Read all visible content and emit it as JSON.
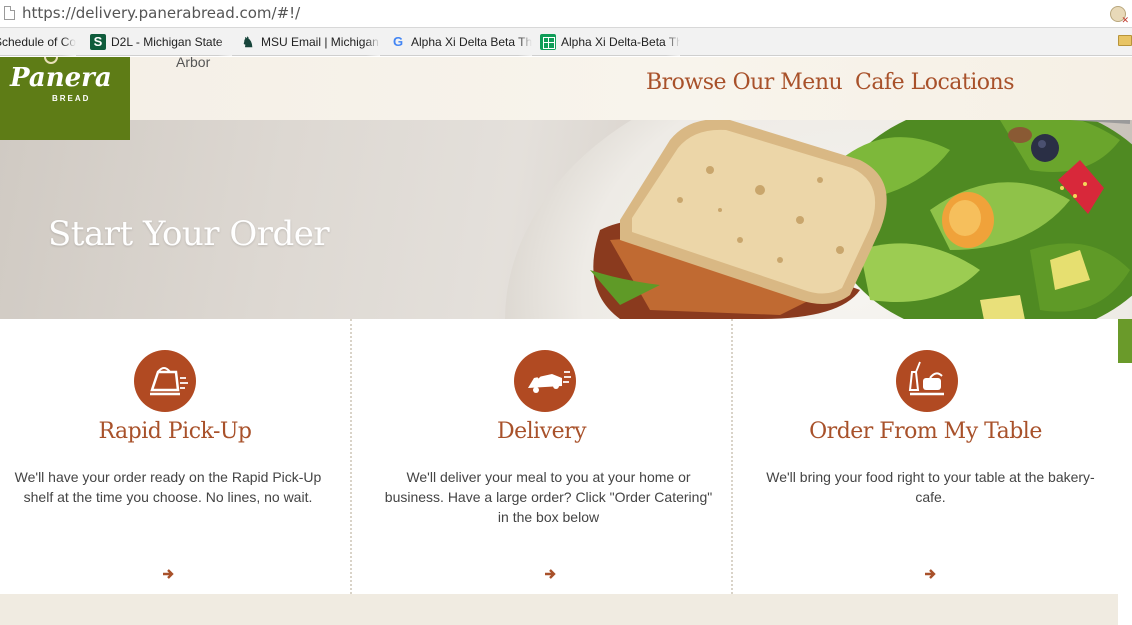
{
  "browser": {
    "url": "https://delivery.panerabread.com/#!/",
    "bookmarks": [
      {
        "label": "Schedule of Cou",
        "icon": "page-icon"
      },
      {
        "label": "D2L - Michigan State",
        "icon": "d2l-icon"
      },
      {
        "label": "MSU Email | Michigan",
        "icon": "spartan-icon"
      },
      {
        "label": "Alpha Xi Delta Beta Th",
        "icon": "google-icon"
      },
      {
        "label": "Alpha Xi Delta-Beta Th",
        "icon": "sheets-icon"
      }
    ]
  },
  "header": {
    "logo_text": "Panera",
    "logo_sub": "BREAD",
    "city_text": "Arbor",
    "nav": [
      "Browse Our Menu",
      "Cafe Locations"
    ]
  },
  "hero": {
    "headline": "Start Your Order"
  },
  "options": [
    {
      "title": "Rapid Pick-Up",
      "description": "We'll have your order ready on the Rapid Pick-Up shelf at the time you choose. No lines, no wait.",
      "icon": "pickup-bag-icon",
      "arrow": "➔"
    },
    {
      "title": "Delivery",
      "description": "We'll deliver your meal to you at your home or business. Have a large order? Click \"Order Catering\" in the box below",
      "icon": "delivery-car-icon",
      "arrow": "➔"
    },
    {
      "title": "Order From My Table",
      "description": "We'll bring your food right to your table at the bakery-cafe.",
      "icon": "table-tray-icon",
      "arrow": "➔"
    }
  ],
  "colors": {
    "brand_green": "#5e7c16",
    "accent_rust": "#a8512a",
    "icon_circle": "#b14a22",
    "header_bg": "#f6f0e5"
  }
}
